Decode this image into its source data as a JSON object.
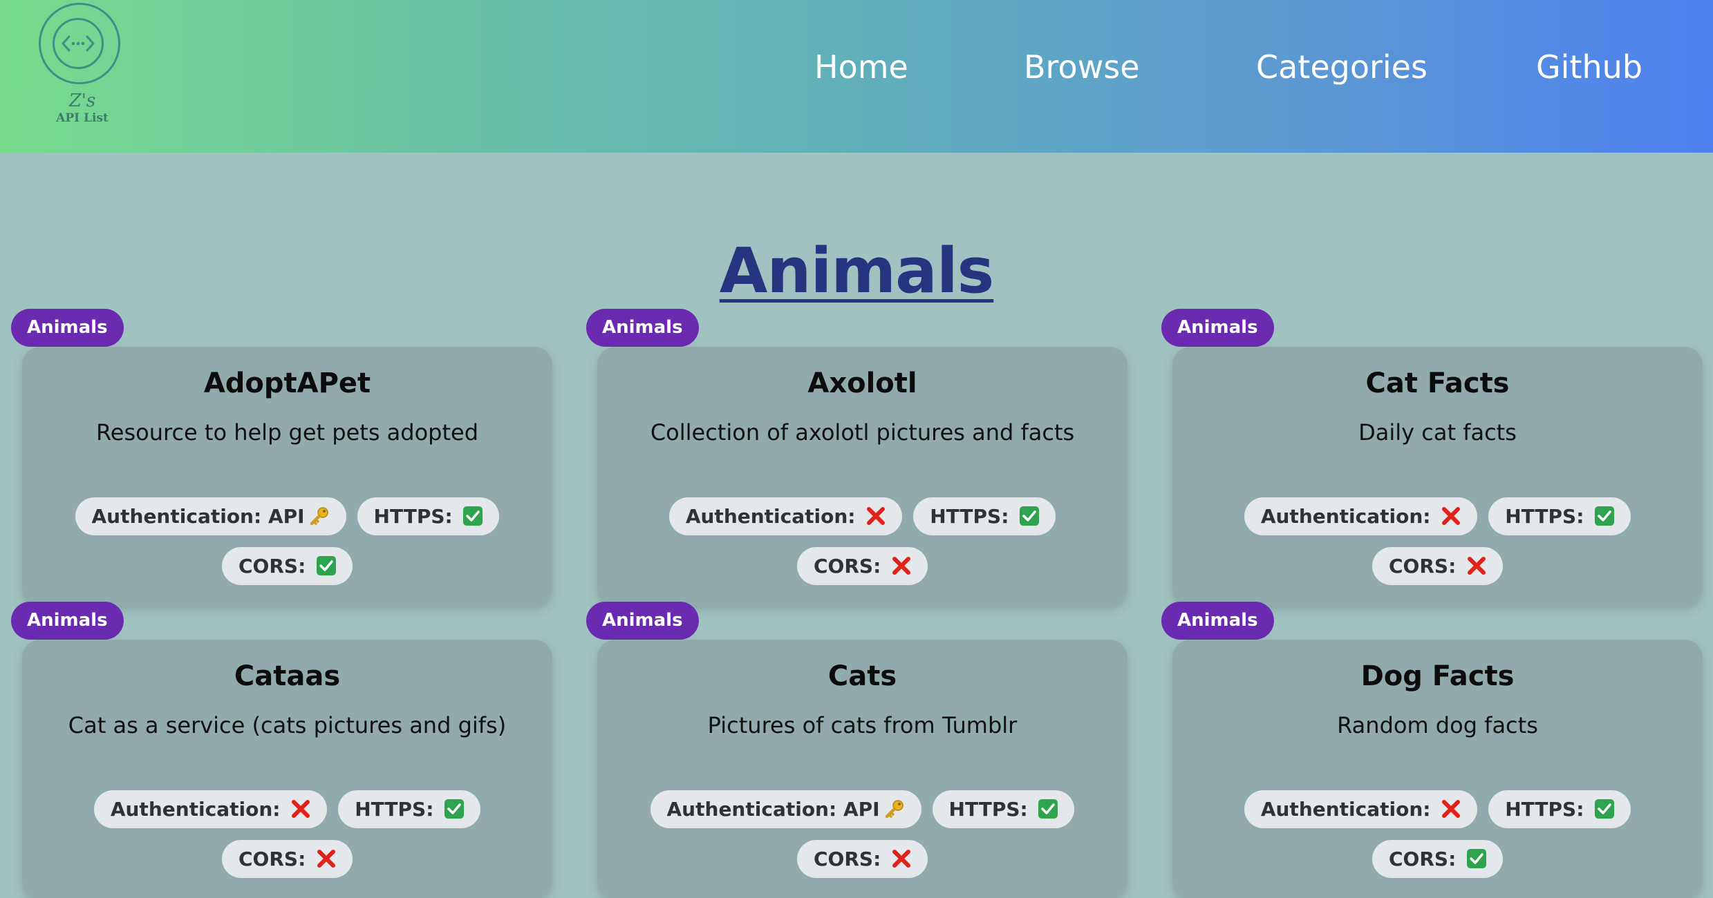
{
  "logo": {
    "line1": "Z's",
    "line2": "API List",
    "icon": "code-brackets-icon"
  },
  "nav": [
    {
      "label": "Home"
    },
    {
      "label": "Browse"
    },
    {
      "label": "Categories"
    },
    {
      "label": "Github"
    }
  ],
  "page_title": "Animals",
  "labels": {
    "auth": "Authentication: ",
    "https": "HTTPS: ",
    "cors": "CORS: "
  },
  "colors": {
    "badge": "#6a2bb0",
    "title": "#25357f",
    "check": "#2ea44f",
    "cross": "#e0221b",
    "key": "#e6b325"
  },
  "cards": [
    {
      "badge": "Animals",
      "title": "AdoptAPet",
      "description": "Resource to help get pets adopted",
      "auth": "API",
      "auth_icon": "key-icon",
      "https_icon": "check-icon",
      "cors_icon": "check-icon"
    },
    {
      "badge": "Animals",
      "title": "Axolotl",
      "description": "Collection of axolotl pictures and facts",
      "auth": "",
      "auth_icon": "cross-icon",
      "https_icon": "check-icon",
      "cors_icon": "cross-icon"
    },
    {
      "badge": "Animals",
      "title": "Cat Facts",
      "description": "Daily cat facts",
      "auth": "",
      "auth_icon": "cross-icon",
      "https_icon": "check-icon",
      "cors_icon": "cross-icon"
    },
    {
      "badge": "Animals",
      "title": "Cataas",
      "description": "Cat as a service (cats pictures and gifs)",
      "auth": "",
      "auth_icon": "cross-icon",
      "https_icon": "check-icon",
      "cors_icon": "cross-icon"
    },
    {
      "badge": "Animals",
      "title": "Cats",
      "description": "Pictures of cats from Tumblr",
      "auth": "API",
      "auth_icon": "key-icon",
      "https_icon": "check-icon",
      "cors_icon": "cross-icon"
    },
    {
      "badge": "Animals",
      "title": "Dog Facts",
      "description": "Random dog facts",
      "auth": "",
      "auth_icon": "cross-icon",
      "https_icon": "check-icon",
      "cors_icon": "check-icon"
    }
  ]
}
